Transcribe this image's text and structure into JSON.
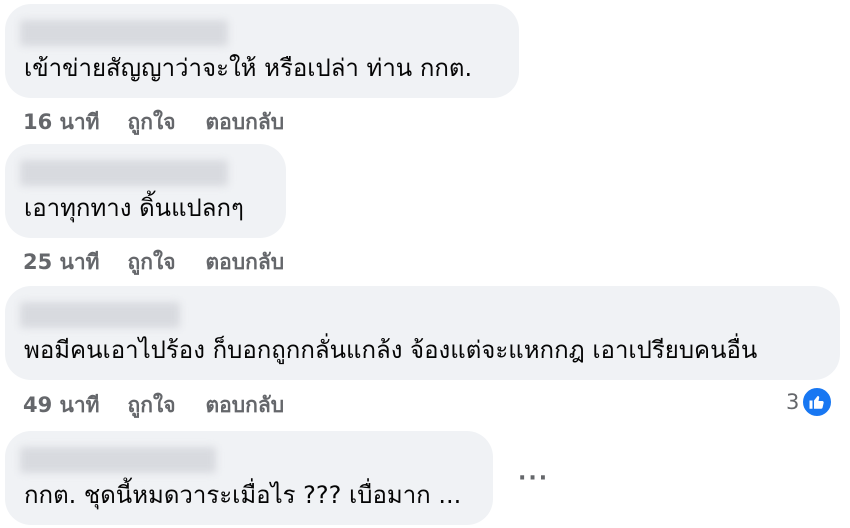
{
  "comments": [
    {
      "text": "เข้าข่ายสัญญาว่าจะให้ หรือเปล่า ท่าน กกต.",
      "time": "16 นาที",
      "like": "ถูกใจ",
      "reply": "ตอบกลับ"
    },
    {
      "text": "เอาทุกทาง ดิ้นแปลกๆ",
      "time": "25 นาที",
      "like": "ถูกใจ",
      "reply": "ตอบกลับ"
    },
    {
      "text": "พอมีคนเอาไปร้อง ก็บอกถูกกลั่นแกล้ง จ้องแต่จะแหกกฎ เอาเปรียบคนอื่น",
      "time": "49 นาที",
      "like": "ถูกใจ",
      "reply": "ตอบกลับ",
      "reaction_count": "3",
      "reaction_icon": "thumbs-up-icon"
    },
    {
      "text": "กกต. ชุดนี้หมดวาระเมื่อไร ??? เบื่อมาก ...",
      "more": "···"
    }
  ],
  "colors": {
    "bubble": "#f0f2f5",
    "text": "#050505",
    "meta": "#65676b",
    "like_blue": "#1877f2"
  }
}
